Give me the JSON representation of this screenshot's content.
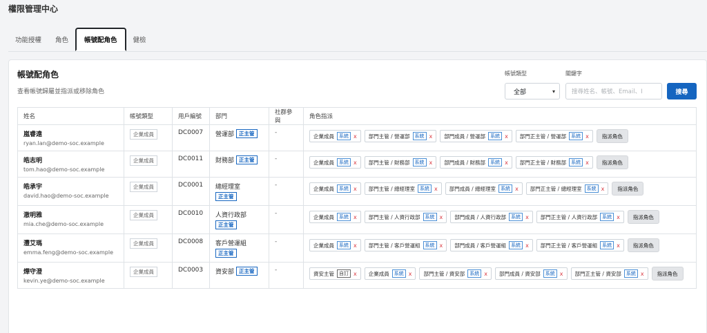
{
  "app_title": "權限管理中心",
  "tabs": [
    "功能授權",
    "角色",
    "帳號配角色",
    "健檢"
  ],
  "card": {
    "title": "帳號配角色",
    "subtitle": "查看帳號歸屬並指派或移除角色"
  },
  "filters": {
    "type_label": "帳號類型",
    "type_value": "全部",
    "keyword_label": "關鍵字",
    "keyword_placeholder": "搜尋姓名、帳號、Email、I",
    "search_label": "搜尋"
  },
  "table": {
    "headers": [
      "姓名",
      "帳號類型",
      "用戶編號",
      "部門",
      "社群參與",
      "角色指派"
    ],
    "assign_label": "指派角色",
    "main_badge": "正主管",
    "rows": [
      {
        "name": "嵐睿遠",
        "email": "ryan.lan@demo-soc.example",
        "type": "企業成員",
        "code": "DC0007",
        "dept": "營運部",
        "badge": "正主管",
        "badge_wrap": false,
        "social": "-",
        "roles": [
          {
            "label": "企業成員",
            "level": "系統"
          },
          {
            "label": "部門主管 / 營運部",
            "level": "系統"
          },
          {
            "label": "部門成員 / 營運部",
            "level": "系統"
          },
          {
            "label": "部門正主管 / 營運部",
            "level": "系統"
          }
        ]
      },
      {
        "name": "皓志明",
        "email": "tom.hao@demo-soc.example",
        "type": "企業成員",
        "code": "DC0011",
        "dept": "財務部",
        "badge": "正主管",
        "badge_wrap": false,
        "social": "-",
        "roles": [
          {
            "label": "企業成員",
            "level": "系統"
          },
          {
            "label": "部門主管 / 財務部",
            "level": "系統"
          },
          {
            "label": "部門成員 / 財務部",
            "level": "系統"
          },
          {
            "label": "部門正主管 / 財務部",
            "level": "系統"
          }
        ]
      },
      {
        "name": "皓承宇",
        "email": "david.hao@demo-soc.example",
        "type": "企業成員",
        "code": "DC0001",
        "dept": "總經理室",
        "badge": "正主管",
        "badge_wrap": true,
        "social": "-",
        "roles": [
          {
            "label": "企業成員",
            "level": "系統"
          },
          {
            "label": "部門主管 / 總經理室",
            "level": "系統"
          },
          {
            "label": "部門成員 / 總經理室",
            "level": "系統"
          },
          {
            "label": "部門正主管 / 總經理室",
            "level": "系統"
          }
        ]
      },
      {
        "name": "澈明雅",
        "email": "mia.che@demo-soc.example",
        "type": "企業成員",
        "code": "DC0010",
        "dept": "人資行政部",
        "badge": "正主管",
        "badge_wrap": true,
        "social": "-",
        "roles": [
          {
            "label": "企業成員",
            "level": "系統"
          },
          {
            "label": "部門主管 / 人資行政部",
            "level": "系統"
          },
          {
            "label": "部門成員 / 人資行政部",
            "level": "系統"
          },
          {
            "label": "部門正主管 / 人資行政部",
            "level": "系統"
          }
        ]
      },
      {
        "name": "灃艾瑪",
        "email": "emma.feng@demo-soc.example",
        "type": "企業成員",
        "code": "DC0008",
        "dept": "客戶營運組",
        "badge": "正主管",
        "badge_wrap": true,
        "social": "-",
        "roles": [
          {
            "label": "企業成員",
            "level": "系統"
          },
          {
            "label": "部門主管 / 客戶營運組",
            "level": "系統"
          },
          {
            "label": "部門成員 / 客戶營運組",
            "level": "系統"
          },
          {
            "label": "部門正主管 / 客戶營運組",
            "level": "系統"
          }
        ]
      },
      {
        "name": "燁守澄",
        "email": "kevin.ye@demo-soc.example",
        "type": "企業成員",
        "code": "DC0003",
        "dept": "資安部",
        "badge": "正主管",
        "badge_wrap": false,
        "social": "-",
        "roles": [
          {
            "label": "資安主管",
            "level": "自訂",
            "custom": true
          },
          {
            "label": "企業成員",
            "level": "系統"
          },
          {
            "label": "部門主管 / 資安部",
            "level": "系統"
          },
          {
            "label": "部門成員 / 資安部",
            "level": "系統"
          },
          {
            "label": "部門正主管 / 資安部",
            "level": "系統"
          }
        ]
      }
    ]
  }
}
